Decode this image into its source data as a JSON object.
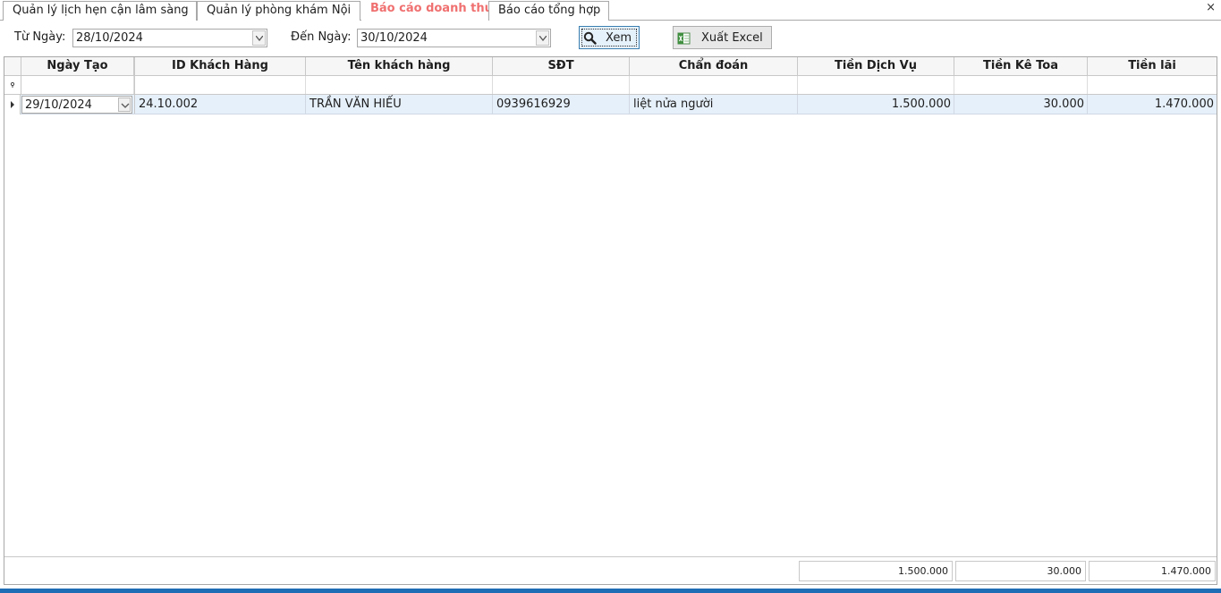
{
  "tabs": [
    {
      "label": "Quản lý lịch hẹn cận lâm sàng"
    },
    {
      "label": "Quản lý phòng khám Nội"
    },
    {
      "label": "Báo cáo doanh thu"
    },
    {
      "label": "Báo cáo tổng hợp"
    }
  ],
  "close_glyph": "×",
  "filter": {
    "from_label": "Từ Ngày:",
    "from_value": "28/10/2024",
    "to_label": "Đến Ngày:",
    "to_value": "30/10/2024",
    "view_button": "Xem",
    "export_button": "Xuất Excel"
  },
  "grid": {
    "columns": [
      "Ngày Tạo",
      "ID Khách Hàng",
      "Tên khách hàng",
      "SĐT",
      "Chẩn đoán",
      "Tiền Dịch Vụ",
      "Tiền Kê Toa",
      "Tiền lãi"
    ],
    "rows": [
      {
        "ngay_tao": "29/10/2024",
        "id_khach_hang": "24.10.002",
        "ten_khach_hang": "TRẦN VĂN HIẾU",
        "sdt": "0939616929",
        "chan_doan": "liệt nửa người",
        "tien_dich_vu": "1.500.000",
        "tien_ke_toa": "30.000",
        "tien_lai": "1.470.000"
      }
    ],
    "totals": {
      "tien_dich_vu": "1.500.000",
      "tien_ke_toa": "30.000",
      "tien_lai": "1.470.000"
    }
  },
  "colors": {
    "active_tab": "#f07070",
    "selected_row": "#e6f0fa",
    "status_bar": "#1f6db5"
  }
}
